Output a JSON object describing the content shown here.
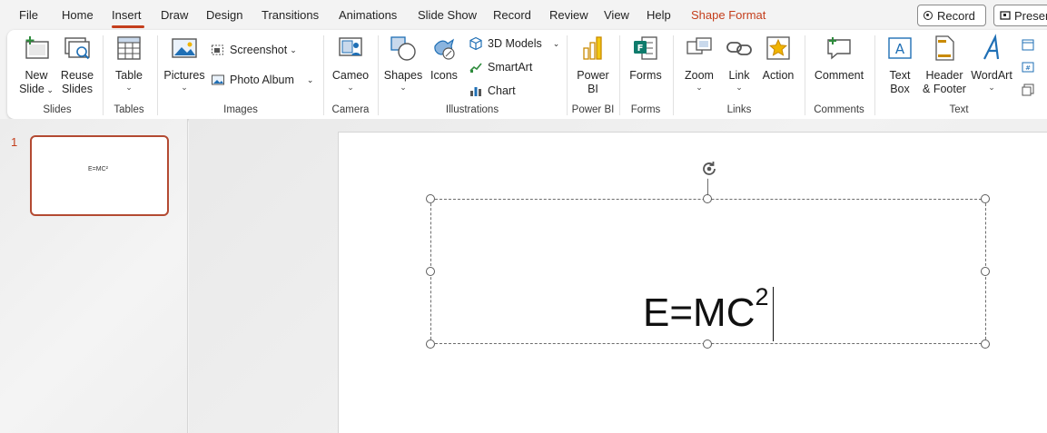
{
  "menu": {
    "tabs": [
      "File",
      "Home",
      "Insert",
      "Draw",
      "Design",
      "Transitions",
      "Animations",
      "Slide Show",
      "Record",
      "Review",
      "View",
      "Help",
      "Shape Format"
    ],
    "active_tab": "Insert",
    "record_button": "Record",
    "present_button": "Present"
  },
  "ribbon": {
    "slides": {
      "new_slide": "New\nSlide",
      "reuse_slides": "Reuse\nSlides",
      "label": "Slides"
    },
    "tables": {
      "table": "Table",
      "label": "Tables"
    },
    "images": {
      "pictures": "Pictures",
      "screenshot": "Screenshot",
      "photo_album": "Photo Album",
      "label": "Images"
    },
    "camera": {
      "cameo": "Cameo",
      "label": "Camera"
    },
    "illustrations": {
      "shapes": "Shapes",
      "icons": "Icons",
      "models_3d": "3D Models",
      "smartart": "SmartArt",
      "chart": "Chart",
      "label": "Illustrations"
    },
    "powerbi": {
      "powerbi": "Power\nBI",
      "label": "Power BI"
    },
    "forms": {
      "forms": "Forms",
      "label": "Forms"
    },
    "links": {
      "zoom": "Zoom",
      "link": "Link",
      "action": "Action",
      "label": "Links"
    },
    "comments": {
      "comment": "Comment",
      "label": "Comments"
    },
    "text": {
      "text_box": "Text\nBox",
      "header_footer": "Header\n& Footer",
      "wordart": "WordArt",
      "label": "Text"
    }
  },
  "slides_panel": {
    "slide_number": "1",
    "thumbnail_text": "E=MC²"
  },
  "slide": {
    "equation_base": "E=MC",
    "equation_exponent": "2"
  },
  "colors": {
    "accent": "#c43e1c",
    "thumb_border": "#b34a32"
  }
}
